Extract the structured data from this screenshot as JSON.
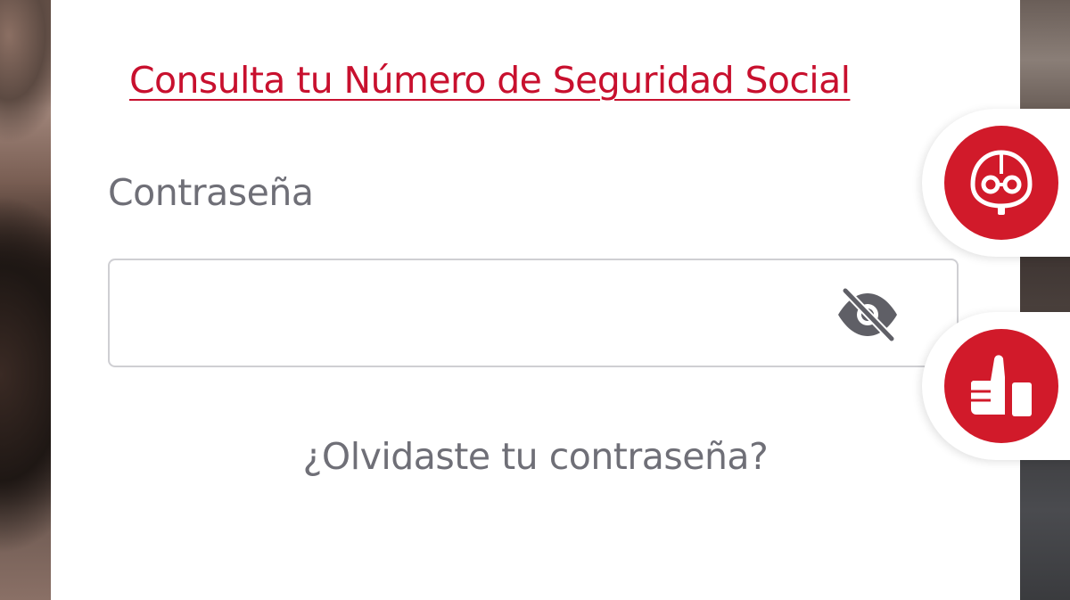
{
  "login_card": {
    "nss_link_label": "Consulta tu Número de Seguridad Social",
    "password_label": "Contraseña",
    "password_value": "",
    "forgot_password_label": "¿Olvidaste tu contraseña?"
  },
  "floating_actions": {
    "assistant_icon": "robot-assistant-icon",
    "feedback_icon": "thumbs-up-icon"
  },
  "colors": {
    "brand_red": "#d11a2a",
    "link_red": "#c8102e",
    "label_gray": "#6f6f77",
    "input_border": "#cfcfd3",
    "icon_gray": "#5f5f66"
  }
}
